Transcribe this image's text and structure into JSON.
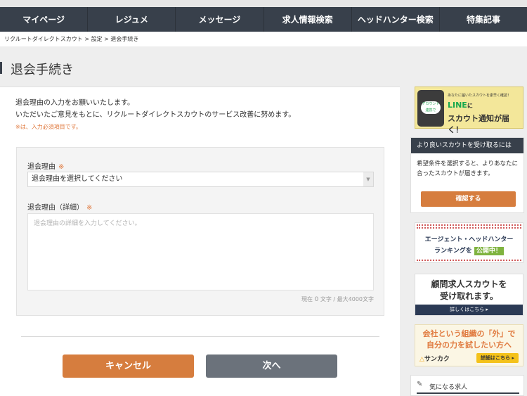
{
  "nav": {
    "items": [
      "マイページ",
      "レジュメ",
      "メッセージ",
      "求人情報検索",
      "ヘッドハンター検索",
      "特集記事"
    ]
  },
  "breadcrumb": [
    "リクルートダイレクトスカウト",
    "設定",
    "退会手続き"
  ],
  "breadcrumb_sep": ">",
  "page_title": "退会手続き",
  "intro": {
    "line1": "退会理由の入力をお願いいたします。",
    "line2": "いただいたご意見をもとに、リクルートダイレクトスカウトのサービス改善に努めます。",
    "required_note": "※は、入力必須項目です。"
  },
  "form": {
    "reason_label": "退会理由",
    "required_mark": "※",
    "reason_select_value": "退会理由を選択してください",
    "detail_label": "退会理由（詳細）",
    "detail_placeholder": "退会理由の詳細を入力してください。",
    "counter_prefix": "現在",
    "counter_value": "0",
    "counter_suffix": "文字 / 最大4000文字"
  },
  "buttons": {
    "cancel": "キャンセル",
    "next": "次へ"
  },
  "sidebar": {
    "line_banner": {
      "small": "あなたに届いたスカウトを素早く確認！",
      "bubble": "アカウント連携で",
      "big1": "LINE",
      "big1_suffix": "に",
      "big2": "スカウト通知が届く！"
    },
    "tip": {
      "header": "より良いスカウトを受け取るには",
      "body": "希望条件を選択すると、よりあなたに合ったスカウトが届きます。",
      "button": "確認する"
    },
    "ranking": {
      "line1": "エージェント・ヘッドハンター",
      "line2": "ランキングを",
      "badge": "公開中！"
    },
    "komon": {
      "line1": "顧問求人スカウトを",
      "line2": "受け取れます。",
      "footer": "詳しくはこちら ▸"
    },
    "sankaku": {
      "line1": "会社という組織の「外」で",
      "line2": "自分の力を試したい方へ",
      "brand": "サンカク",
      "button": "詳細はこちら ▸"
    },
    "favorite": {
      "label": "気になる求人"
    }
  },
  "colors": {
    "nav_bg": "#38404b",
    "accent_orange": "#d67d3e",
    "button_gray": "#6b727b",
    "required_orange": "#e07a3f"
  }
}
